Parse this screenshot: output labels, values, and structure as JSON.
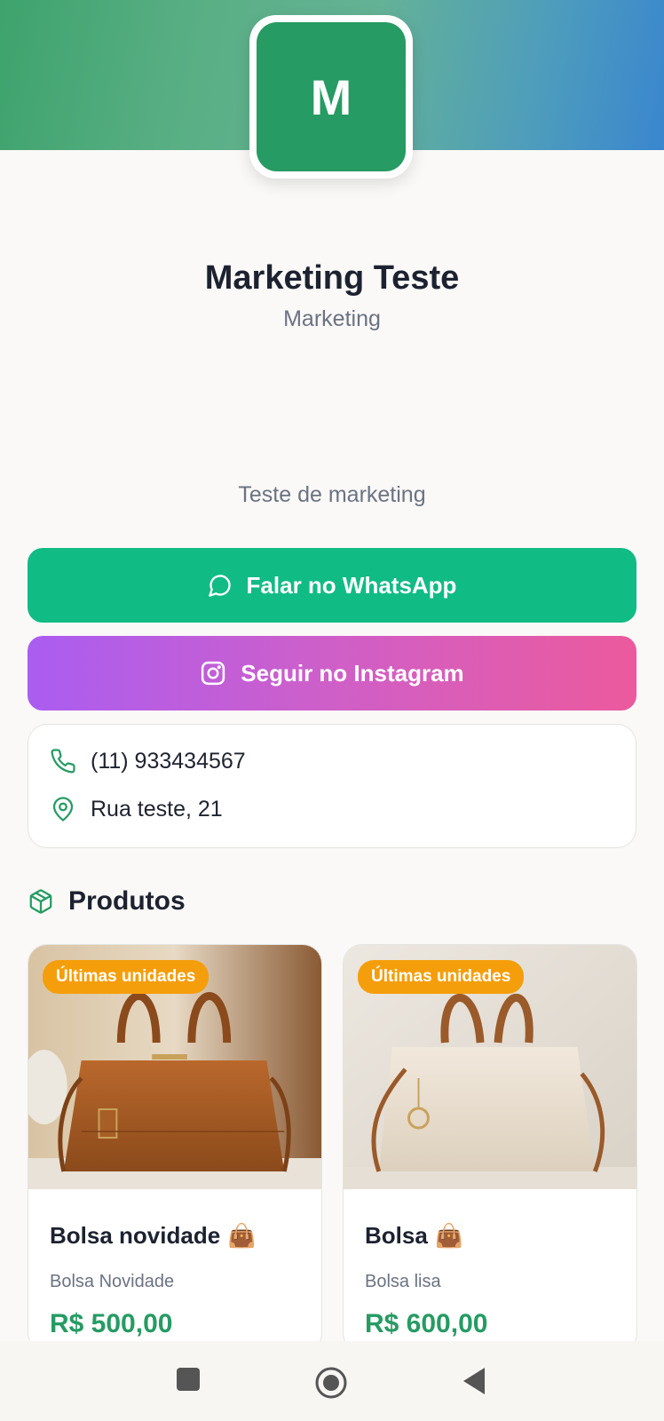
{
  "profile": {
    "initial": "M",
    "name": "Marketing Teste",
    "category": "Marketing",
    "description": "Teste de marketing"
  },
  "actions": {
    "whatsapp_label": "Falar no WhatsApp",
    "instagram_label": "Seguir no Instagram"
  },
  "contact": {
    "phone": "(11) 933434567",
    "address": "Rua teste, 21"
  },
  "products": {
    "section_title": "Produtos",
    "items": [
      {
        "badge": "Últimas unidades",
        "title": "Bolsa novidade",
        "emoji": "👜",
        "subtitle": "Bolsa Novidade",
        "price": "R$ 500,00"
      },
      {
        "badge": "Últimas unidades",
        "title": "Bolsa",
        "emoji": "👜",
        "subtitle": "Bolsa lisa",
        "price": "R$ 600,00"
      }
    ]
  },
  "colors": {
    "brand_green": "#269b63",
    "whatsapp_green": "#11bb84",
    "badge_orange": "#f59e0b",
    "instagram_gradient_start": "#aa5df1",
    "instagram_gradient_end": "#ec5a9d"
  },
  "icons": {
    "whatsapp": "message-circle-icon",
    "instagram": "instagram-icon",
    "phone": "phone-icon",
    "address": "map-pin-icon",
    "products": "package-icon"
  },
  "navigation": [
    "recents-button",
    "home-button",
    "back-button"
  ]
}
